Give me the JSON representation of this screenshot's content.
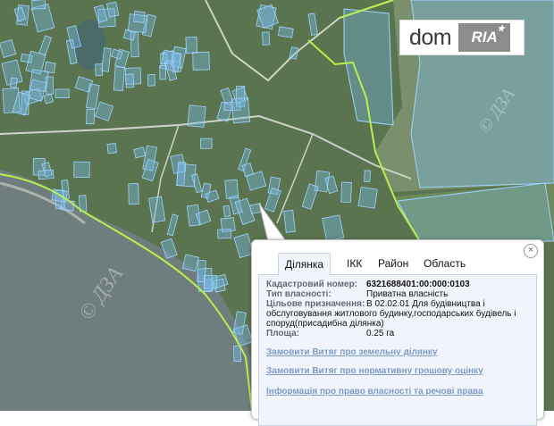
{
  "map": {
    "colors": {
      "water": "#6d7c7d",
      "land": "#5e7a52",
      "parcel_fill": "rgba(120,190,240,0.38)",
      "parcel_stroke": "#9fd4ff",
      "boundary": "#b7f04a",
      "road": "#cfd2c8"
    },
    "watermarks": [
      "© ДЗА",
      "© ДЗА"
    ]
  },
  "logo": {
    "brand_left": "dom",
    "brand_right": "RIA",
    "star": "★"
  },
  "popup": {
    "close_icon": "×",
    "tabs": [
      "Ділянка",
      "ІКК",
      "Район",
      "Область"
    ],
    "active_tab": "Ділянка",
    "fields": [
      {
        "label": "Кадастровий номер:",
        "value": "6321688401:00:000:0103"
      },
      {
        "label": "Тип власності:",
        "value": "Приватна власність"
      },
      {
        "label": "Цільове призначення:",
        "value": "В 02.02.01 Для будівництва і"
      },
      {
        "label": "",
        "value": "обслуговування житлового будинку,господарських будівель і споруд(присадибна ділянка)"
      },
      {
        "label": "Площа:",
        "value": "0.25 га"
      }
    ],
    "links": [
      "Замовити Витяг про земельну ділянку",
      "Замовити Витяг про нормативну грошову оцінку",
      "Інформація про право власності та речові права"
    ]
  }
}
